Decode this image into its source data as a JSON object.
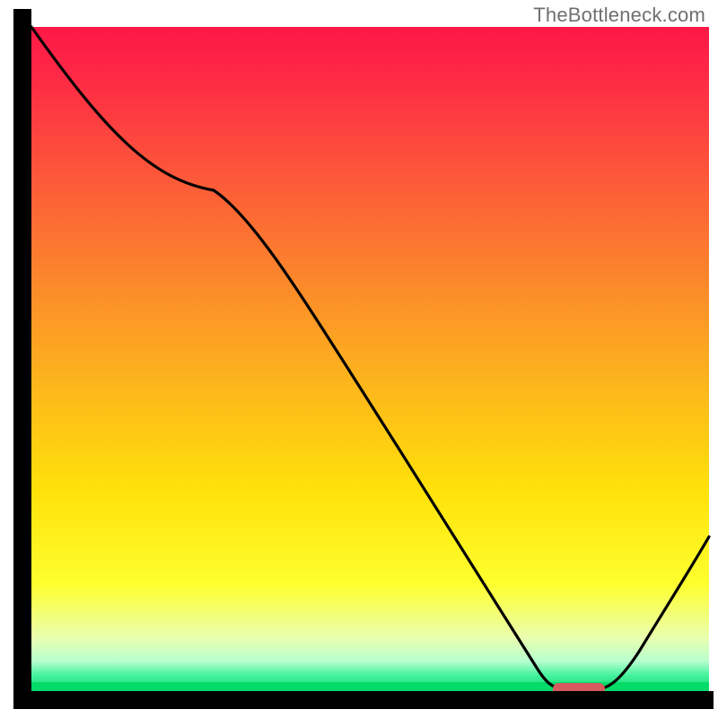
{
  "watermark": "TheBottleneck.com",
  "chart_data": {
    "type": "line",
    "title": "",
    "xlabel": "",
    "ylabel": "",
    "xlim": [
      0,
      100
    ],
    "ylim": [
      0,
      100
    ],
    "series": [
      {
        "name": "curve",
        "x": [
          0,
          27,
          75,
          82,
          100
        ],
        "y": [
          100,
          76,
          0,
          0,
          26
        ]
      }
    ],
    "optimal_marker": {
      "x_start": 75,
      "x_end": 82,
      "y": 0
    },
    "gradient_colors": {
      "top": "#fd1846",
      "upper_mid": "#fc9226",
      "mid": "#ffe808",
      "lower_mid": "#f6ff6f",
      "bottom_band": "#08e06e"
    },
    "axis_color": "#000000",
    "curve_color": "#000000",
    "marker_color": "#d65a5f"
  }
}
